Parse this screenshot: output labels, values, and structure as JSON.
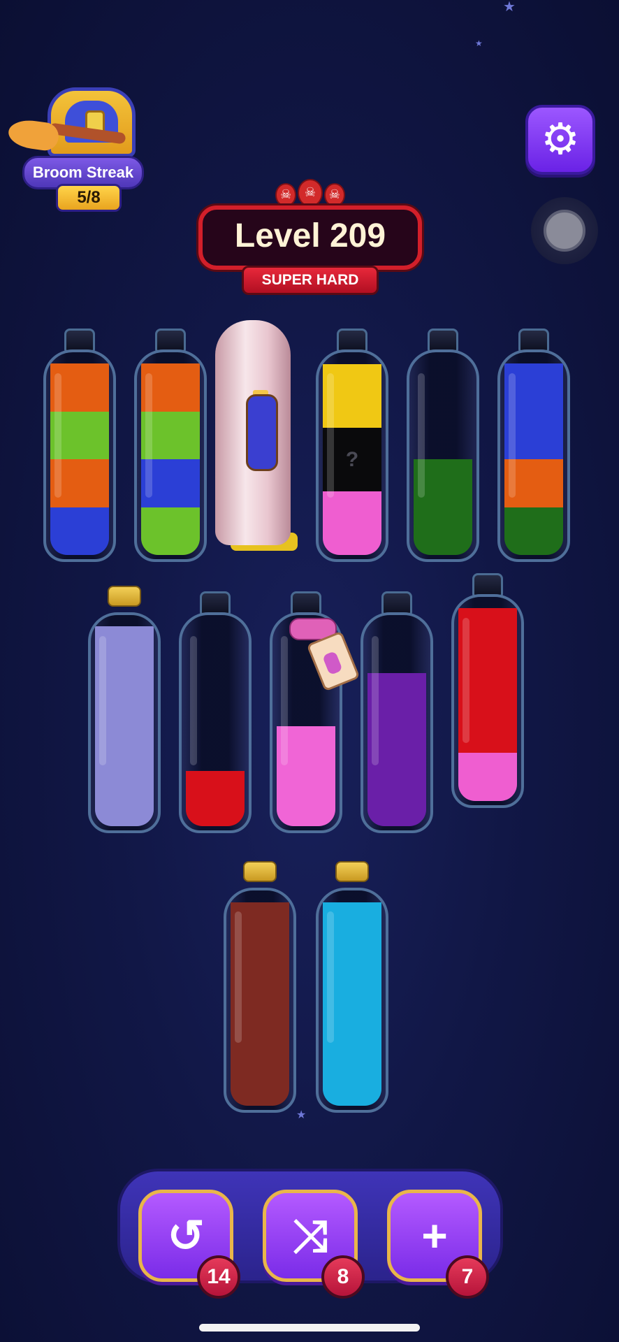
{
  "streak": {
    "title": "Broom Streak",
    "progress": "5/8"
  },
  "settings": {
    "icon": "gear-icon"
  },
  "level": {
    "title": "Level 209",
    "difficulty": "SUPER HARD",
    "skulls": [
      "☠",
      "☠",
      "☠"
    ]
  },
  "bottles": {
    "row1": [
      {
        "layers": [
          "#2b3fd6",
          "#e45d12",
          "#6cc22b",
          "#e45d12"
        ],
        "fill": 0.94,
        "cap": "neck"
      },
      {
        "layers": [
          "#6cc22b",
          "#2b3fd6",
          "#6cc22b",
          "#e45d12"
        ],
        "fill": 0.94,
        "cap": "neck"
      },
      {
        "covered": true
      },
      {
        "layers": [
          "#ef5ed0",
          "mystery",
          "#f0c814"
        ],
        "fill": 0.94,
        "cap": "neck",
        "mystery_label": "?"
      },
      {
        "layers": [
          "#1f6e1a"
        ],
        "fill": 0.47,
        "cap": "neck"
      },
      {
        "layers": [
          "#1f6e1a",
          "#e45d12",
          "#2b3fd6",
          "#2b3fd6"
        ],
        "fill": 0.94,
        "cap": "neck"
      }
    ],
    "row2": [
      {
        "layers": [
          "#8c8ad6"
        ],
        "fill": 0.94,
        "cap": "cork"
      },
      {
        "layers": [
          "#d8101a"
        ],
        "fill": 0.26,
        "cap": "neck"
      },
      {
        "layers": [
          "#f065d6"
        ],
        "fill": 0.47,
        "cap": "neck",
        "locked": true
      },
      {
        "layers": [
          "#6a1fa8"
        ],
        "fill": 0.72,
        "cap": "neck"
      },
      {
        "layers": [
          "#ef5ed0",
          "#d8101a",
          "#d8101a",
          "#d8101a"
        ],
        "fill": 0.94,
        "cap": "neck"
      }
    ],
    "row3": [
      {
        "layers": [
          "#7e2a22"
        ],
        "fill": 0.94,
        "cap": "cork"
      },
      {
        "layers": [
          "#19aee0"
        ],
        "fill": 0.94,
        "cap": "cork"
      }
    ]
  },
  "powerups": [
    {
      "name": "undo",
      "icon": "undo-icon",
      "glyph": "↺",
      "count": "14"
    },
    {
      "name": "shuffle",
      "icon": "shuffle-icon",
      "glyph": "⤨",
      "count": "8"
    },
    {
      "name": "add-bottle",
      "icon": "add-bottle-icon",
      "glyph": "+",
      "count": "7"
    }
  ]
}
